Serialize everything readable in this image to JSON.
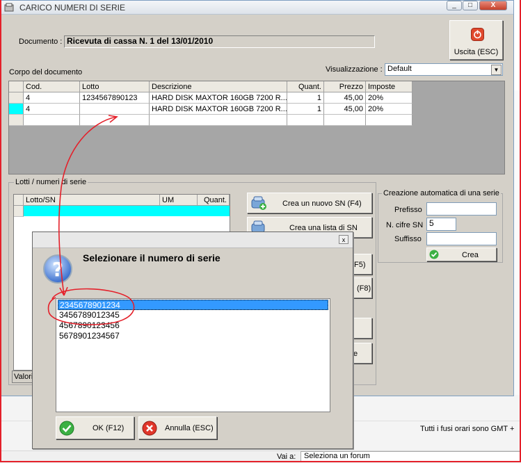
{
  "window": {
    "title": "CARICO NUMERI DI SERIE",
    "min": "_",
    "max": "□",
    "close": "X"
  },
  "documento": {
    "label": "Documento :",
    "value": "Ricevuta di cassa N. 1 del 13/01/2010"
  },
  "exit_button": {
    "label": "Uscita (ESC)"
  },
  "corpo_label": "Corpo del documento",
  "visualizzazione": {
    "label": "Visualizzazione :",
    "value": "Default"
  },
  "grid": {
    "headers": [
      "Cod.",
      "Lotto",
      "Descrizione",
      "Quant.",
      "Prezzo",
      "Imposte"
    ],
    "rows": [
      [
        "4",
        "1234567890123",
        "HARD DISK MAXTOR 160GB 7200 R...",
        "1",
        "45,00",
        "20%"
      ],
      [
        "4",
        "",
        "HARD DISK MAXTOR 160GB 7200 R...",
        "1",
        "45,00",
        "20%"
      ]
    ]
  },
  "lotti_group": {
    "title": "Lotti / numeri di serie",
    "headers": [
      "Lotto/SN",
      "UM",
      "Quant."
    ],
    "footer_text": "Valori"
  },
  "buttons": {
    "crea_nuovo": "Crea un nuovo SN (F4)",
    "crea_lista": "Crea una lista di SN",
    "f5": "F5)",
    "f8": "(F8)",
    "partial_e": "e"
  },
  "auto_group": {
    "title": "Creazione automatica di una serie",
    "prefisso_label": "Prefisso",
    "prefisso_value": "",
    "cifre_label": "N. cifre SN",
    "cifre_value": "5",
    "suffisso_label": "Suffisso",
    "suffisso_value": "",
    "crea_button": "Crea"
  },
  "dialog": {
    "close": "x",
    "heading": "Selezionare il numero di serie",
    "items": [
      "2345678901234",
      "3456789012345",
      "4567890123456",
      "5678901234567"
    ],
    "selected_index": 0,
    "ok_button": "OK (F12)",
    "cancel_button": "Annulla (ESC)"
  },
  "background_page": {
    "timezone_text": "Tutti i fusi orari sono GMT +",
    "vai_label": "Vai a:",
    "forum_select": "Seleziona un forum"
  },
  "colors": {
    "selection": "#3399ff",
    "cyan_row": "#00ffff",
    "annotation": "#e4202a"
  }
}
